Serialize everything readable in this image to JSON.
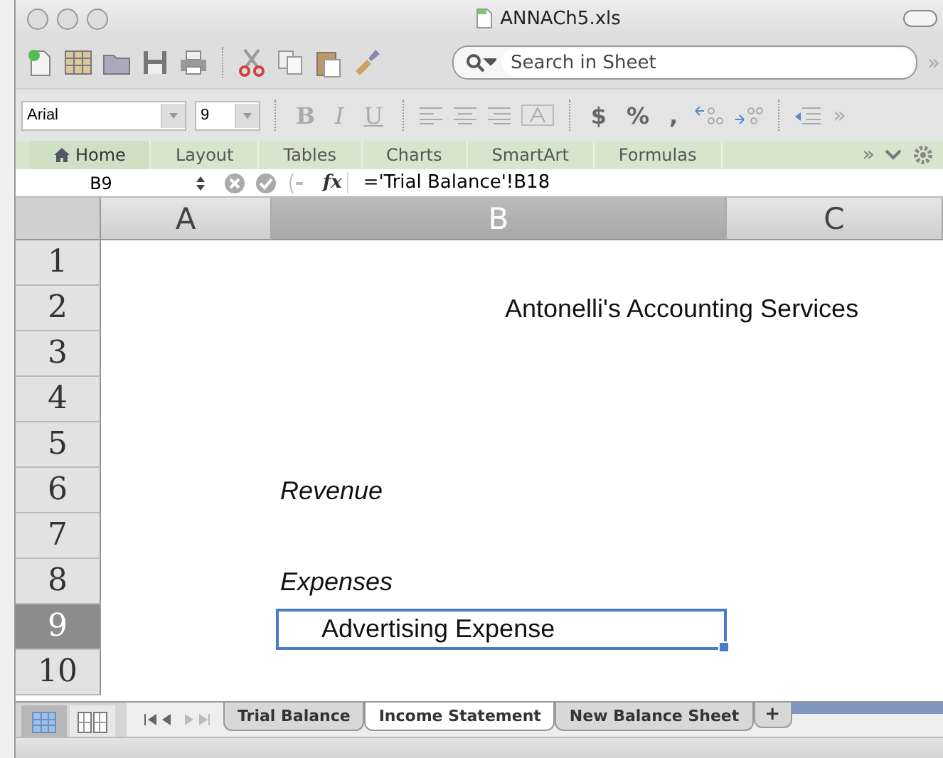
{
  "window": {
    "title": "ANNACh5.xls"
  },
  "toolbar": {
    "search": {
      "placeholder": "Search in Sheet"
    },
    "overflow": "»"
  },
  "format_bar": {
    "font": "Arial",
    "size": "9",
    "style_buttons": [
      "B",
      "I",
      "U"
    ],
    "number_buttons": [
      "$",
      "%",
      ","
    ],
    "overflow": "»"
  },
  "ribbon_tabs": [
    {
      "label": "Home",
      "selected": true
    },
    {
      "label": "Layout",
      "selected": false
    },
    {
      "label": "Tables",
      "selected": false
    },
    {
      "label": "Charts",
      "selected": false
    },
    {
      "label": "SmartArt",
      "selected": false
    },
    {
      "label": "Formulas",
      "selected": false
    }
  ],
  "ribbon_overflow": "»",
  "formula_bar": {
    "cell_ref": "B9",
    "fx": "fx",
    "formula": "='Trial Balance'!B18"
  },
  "columns": [
    {
      "label": "A",
      "selected": false
    },
    {
      "label": "B",
      "selected": true
    },
    {
      "label": "C",
      "selected": false
    }
  ],
  "rows": [
    {
      "label": "1",
      "selected": false
    },
    {
      "label": "2",
      "selected": false,
      "cell_b": {
        "text": "Antonelli's Accounting Services",
        "kind": "title",
        "selected": false
      }
    },
    {
      "label": "3",
      "selected": false
    },
    {
      "label": "4",
      "selected": false
    },
    {
      "label": "5",
      "selected": false
    },
    {
      "label": "6",
      "selected": false,
      "cell_b": {
        "text": "Revenue",
        "kind": "italic",
        "selected": false
      }
    },
    {
      "label": "7",
      "selected": false
    },
    {
      "label": "8",
      "selected": false,
      "cell_b": {
        "text": "Expenses",
        "kind": "italic",
        "selected": false
      }
    },
    {
      "label": "9",
      "selected": true,
      "cell_b": {
        "text": "Advertising Expense",
        "kind": "indented",
        "selected": true
      }
    },
    {
      "label": "10",
      "selected": false
    }
  ],
  "views": [
    {
      "kind": "normal",
      "selected": true
    },
    {
      "kind": "page_layout",
      "selected": false
    }
  ],
  "sheet_tabs": [
    {
      "label": "Trial Balance",
      "selected": false
    },
    {
      "label": "Income Statement",
      "selected": true
    },
    {
      "label": "New Balance Sheet",
      "selected": false
    }
  ],
  "add_sheet": "+"
}
